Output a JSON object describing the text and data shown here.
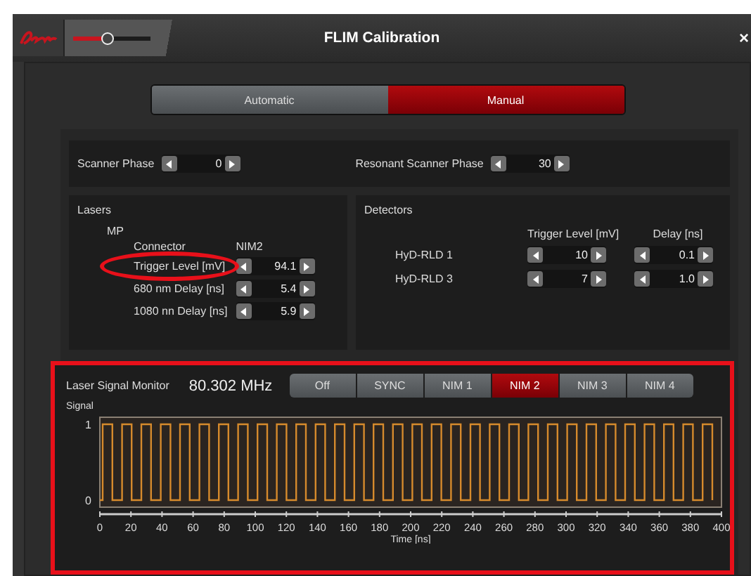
{
  "window": {
    "title": "FLIM Calibration",
    "close": "×"
  },
  "title_slider": {
    "level": 0.45
  },
  "mode_tabs": [
    {
      "label": "Automatic",
      "selected": false
    },
    {
      "label": "Manual",
      "selected": true
    }
  ],
  "scanner": [
    {
      "label": "Scanner Phase",
      "value": "0"
    },
    {
      "label": "Resonant Scanner Phase",
      "value": "30"
    }
  ],
  "lasers": {
    "title": "Lasers",
    "laser": "MP",
    "header_label": "Connector",
    "header_value": "NIM2",
    "rows": [
      {
        "label": "Trigger Level [mV]",
        "value": "94.1",
        "highlighted": true
      },
      {
        "label": "680 nm  Delay [ns]",
        "value": "5.4",
        "highlighted": false
      },
      {
        "label": "1080 nn Delay [ns]",
        "value": "5.9",
        "highlighted": false
      }
    ]
  },
  "detectors": {
    "title": "Detectors",
    "columns": [
      "Trigger Level [mV]",
      "Delay [ns]"
    ],
    "rows": [
      {
        "name": "HyD-RLD 1",
        "values": [
          "10",
          "0.1"
        ]
      },
      {
        "name": "HyD-RLD 3",
        "values": [
          "7",
          "1.0"
        ]
      }
    ]
  },
  "monitor": {
    "highlighted": true,
    "label": "Laser Signal Monitor",
    "frequency": "80.302 MHz",
    "sources": [
      {
        "label": "Off",
        "selected": false
      },
      {
        "label": "SYNC",
        "selected": false
      },
      {
        "label": "NIM 1",
        "selected": false
      },
      {
        "label": "NIM 2",
        "selected": true
      },
      {
        "label": "NIM 3",
        "selected": false
      },
      {
        "label": "NIM 4",
        "selected": false
      }
    ],
    "plot": {
      "ylabel": "Signal",
      "xlabel": "Time [ns]",
      "yticks": [
        "1",
        "0"
      ],
      "xticks": [
        "0",
        "20",
        "40",
        "60",
        "80",
        "100",
        "120",
        "140",
        "160",
        "180",
        "200",
        "220",
        "240",
        "260",
        "280",
        "300",
        "320",
        "340",
        "360",
        "380",
        "400"
      ]
    }
  }
}
